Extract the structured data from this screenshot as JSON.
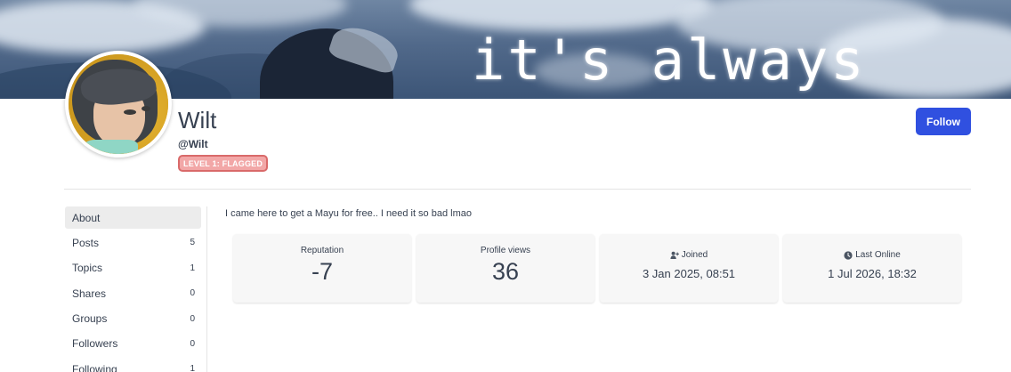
{
  "cover": {
    "text": "it's always"
  },
  "profile": {
    "display_name": "Wilt",
    "username": "@Wilt",
    "badge": "LEVEL 1: FLAGGED",
    "follow_label": "Follow",
    "bio": "I came here to get a Mayu for free.. I need it so bad lmao"
  },
  "sidebar": {
    "items": [
      {
        "label": "About",
        "count": ""
      },
      {
        "label": "Posts",
        "count": "5"
      },
      {
        "label": "Topics",
        "count": "1"
      },
      {
        "label": "Shares",
        "count": "0"
      },
      {
        "label": "Groups",
        "count": "0"
      },
      {
        "label": "Followers",
        "count": "0"
      },
      {
        "label": "Following",
        "count": "1"
      }
    ]
  },
  "stats": {
    "reputation": {
      "label": "Reputation",
      "value": "-7"
    },
    "profile_views": {
      "label": "Profile views",
      "value": "36"
    },
    "joined": {
      "label": "Joined",
      "value": "3 Jan 2025, 08:51",
      "icon": "user-plus-icon"
    },
    "last_online": {
      "label": "Last Online",
      "value": "1 Jul 2026, 18:32",
      "icon": "clock-icon"
    }
  },
  "colors": {
    "accent": "#3050e0",
    "badge_bg": "#f2a7a7",
    "badge_border": "#d96a6a"
  }
}
